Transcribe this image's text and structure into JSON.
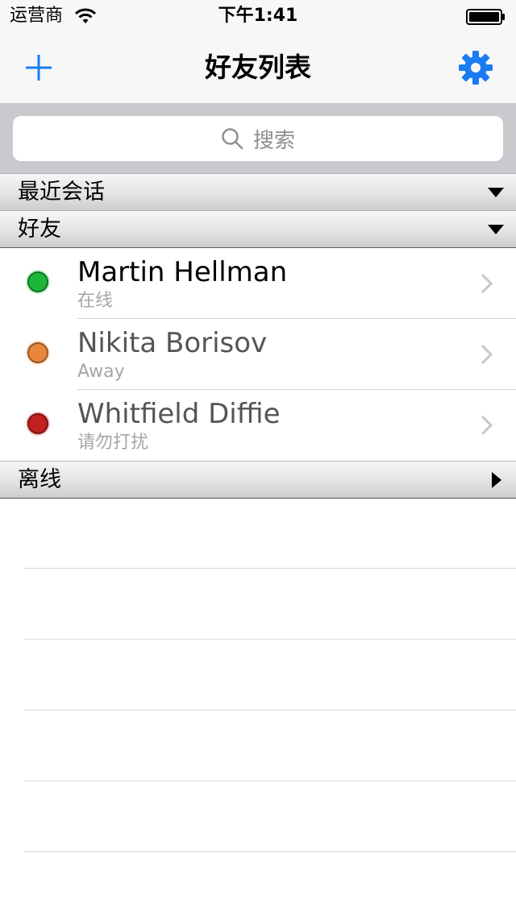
{
  "status_bar": {
    "carrier": "运营商",
    "time": "下午1:41",
    "wifi_icon": "wifi-icon",
    "battery_icon": "battery-icon"
  },
  "nav": {
    "title": "好友列表",
    "add_icon": "plus-icon",
    "settings_icon": "gear-icon",
    "accent_color": "#1a7cf2"
  },
  "search": {
    "placeholder": "搜索",
    "icon": "search-icon"
  },
  "sections": {
    "recent": {
      "title": "最近会话",
      "expanded": true
    },
    "friends": {
      "title": "好友",
      "expanded": true
    },
    "offline": {
      "title": "离线",
      "expanded": false
    }
  },
  "friends": [
    {
      "name": "Martin Hellman",
      "status": "在线",
      "presence": "online",
      "dot_color": "#1db63a",
      "name_color": "#000000"
    },
    {
      "name": "Nikita Borisov",
      "status": "Away",
      "presence": "away",
      "dot_color": "#e8873b",
      "name_color": "#555555"
    },
    {
      "name": "Whitfield Diffie",
      "status": "请勿打扰",
      "presence": "busy",
      "dot_color": "#c02020",
      "name_color": "#555555"
    }
  ]
}
